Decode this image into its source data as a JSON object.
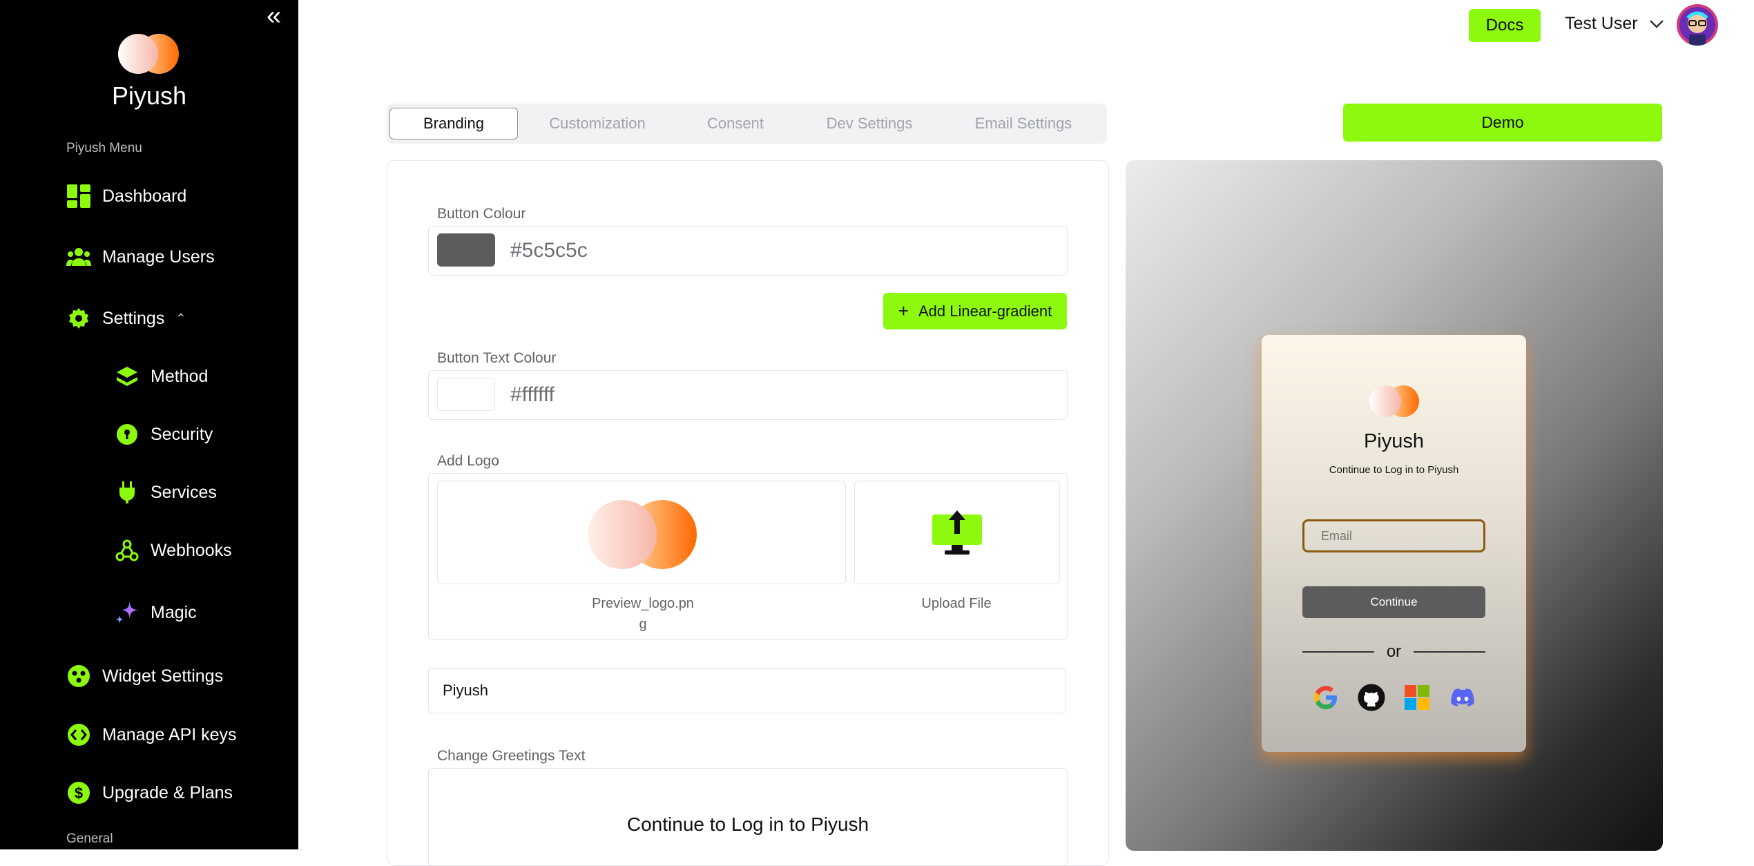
{
  "sidebar": {
    "brand": "Piyush",
    "menu_heading": "Piyush Menu",
    "items": [
      {
        "label": "Dashboard"
      },
      {
        "label": "Manage Users"
      },
      {
        "label": "Settings"
      },
      {
        "label": "Method"
      },
      {
        "label": "Security"
      },
      {
        "label": "Services"
      },
      {
        "label": "Webhooks"
      },
      {
        "label": "Magic"
      },
      {
        "label": "Widget Settings"
      },
      {
        "label": "Manage API keys"
      },
      {
        "label": "Upgrade & Plans"
      }
    ],
    "general_heading": "General"
  },
  "header": {
    "docs_label": "Docs",
    "user_name": "Test User"
  },
  "tabs": [
    {
      "label": "Branding",
      "active": true
    },
    {
      "label": "Customization",
      "active": false
    },
    {
      "label": "Consent",
      "active": false
    },
    {
      "label": "Dev Settings",
      "active": false
    },
    {
      "label": "Email Settings",
      "active": false
    }
  ],
  "demo_label": "Demo",
  "branding": {
    "button_colour_label": "Button Colour",
    "button_colour_value": "#5c5c5c",
    "add_gradient_label": "Add Linear-gradient",
    "button_text_colour_label": "Button Text Colour",
    "button_text_colour_value": "#ffffff",
    "add_logo_label": "Add Logo",
    "preview_logo_caption_line1": "Preview_logo.pn",
    "preview_logo_caption_line2": "g",
    "upload_caption": "Upload File",
    "app_name_value": "Piyush",
    "greetings_label": "Change Greetings Text",
    "greetings_value": "Continue to Log in to Piyush"
  },
  "preview": {
    "title": "Piyush",
    "subtitle": "Continue to Log in to Piyush",
    "email_placeholder": "Email",
    "continue_label": "Continue",
    "or_label": "or"
  },
  "colors": {
    "accent": "#8cf90f",
    "sidebar_bg": "#000000",
    "button_colour": "#5c5c5c"
  }
}
